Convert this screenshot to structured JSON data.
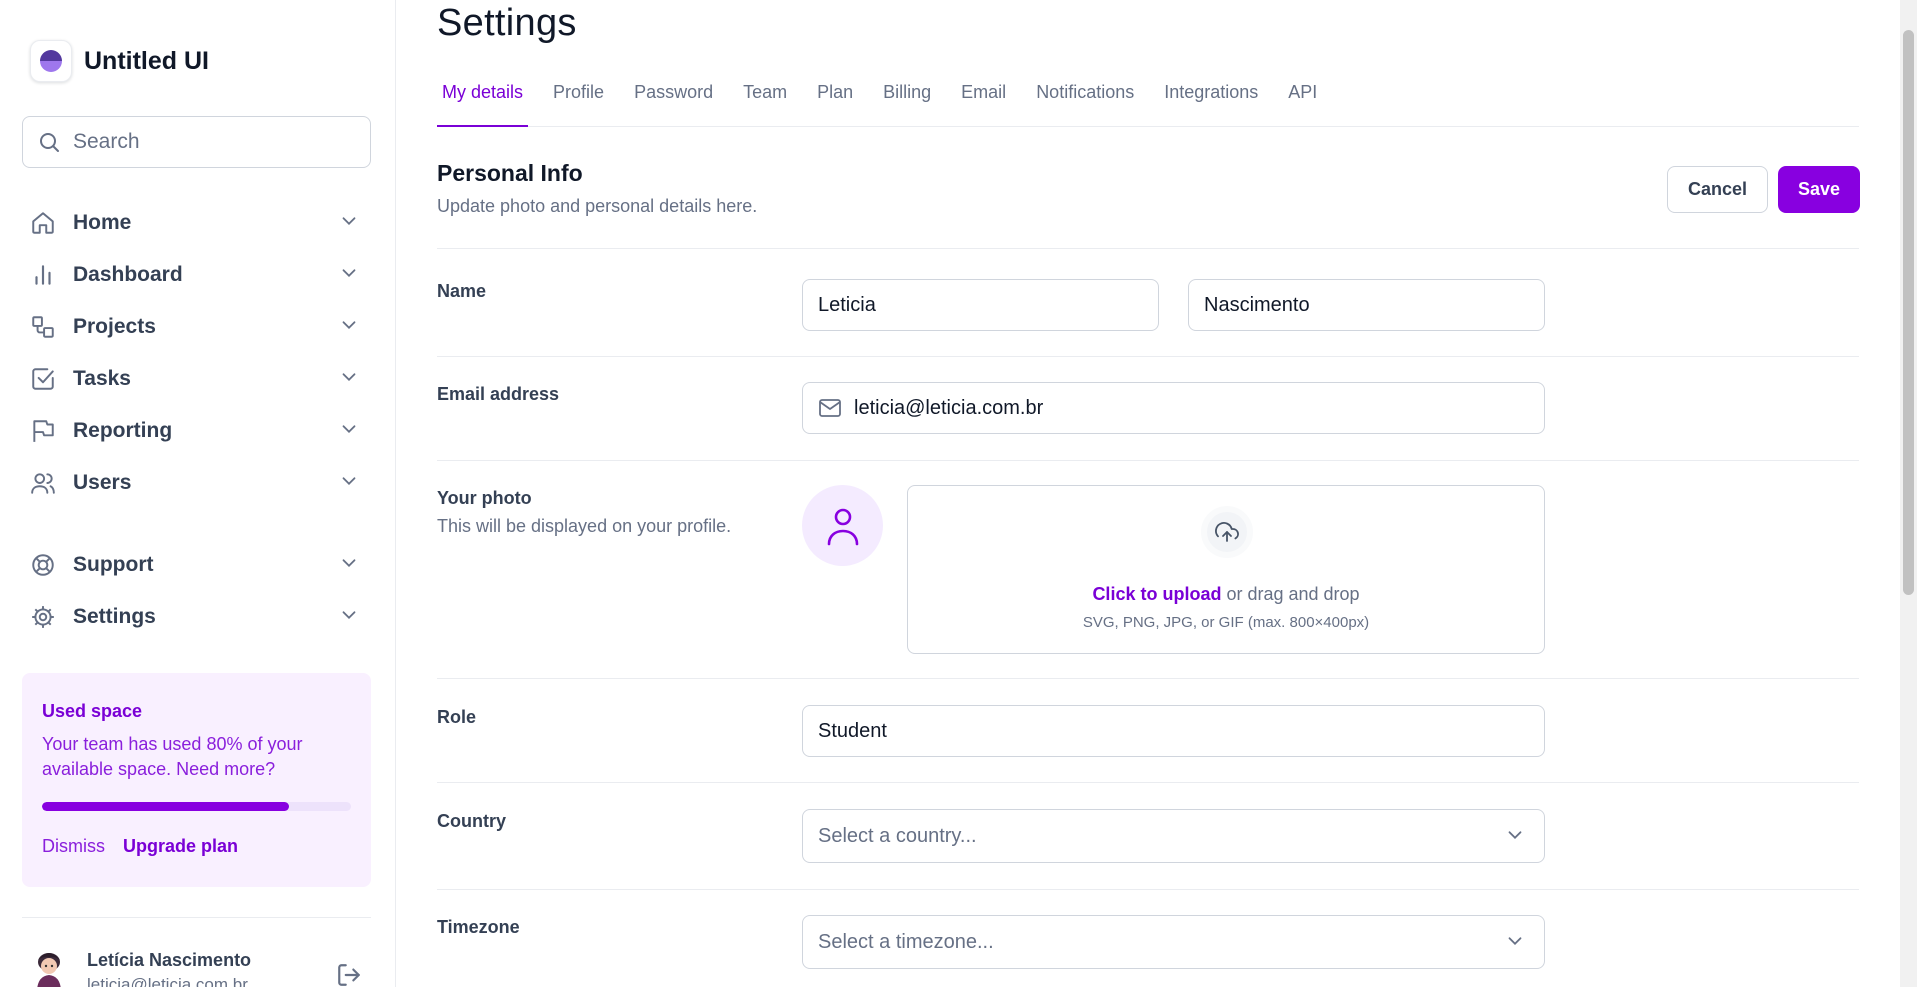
{
  "app": {
    "name": "Untitled UI"
  },
  "search": {
    "placeholder": "Search"
  },
  "sidebar": {
    "items": [
      {
        "label": "Home",
        "icon": "home-icon"
      },
      {
        "label": "Dashboard",
        "icon": "bar-chart-icon"
      },
      {
        "label": "Projects",
        "icon": "layers-icon"
      },
      {
        "label": "Tasks",
        "icon": "check-square-icon"
      },
      {
        "label": "Reporting",
        "icon": "flag-icon"
      },
      {
        "label": "Users",
        "icon": "users-icon"
      },
      {
        "label": "Support",
        "icon": "life-buoy-icon"
      },
      {
        "label": "Settings",
        "icon": "gear-icon"
      }
    ],
    "usage": {
      "title": "Used space",
      "text": "Your team has used 80% of your available space. Need more?",
      "percent": 80,
      "dismiss": "Dismiss",
      "upgrade": "Upgrade plan"
    },
    "user": {
      "name": "Letícia Nascimento",
      "email": "leticia@leticia.com.br"
    }
  },
  "page": {
    "title": "Settings",
    "tabs": [
      "My details",
      "Profile",
      "Password",
      "Team",
      "Plan",
      "Billing",
      "Email",
      "Notifications",
      "Integrations",
      "API"
    ],
    "active_tab": "My details"
  },
  "section": {
    "title": "Personal Info",
    "subtitle": "Update photo and personal details here.",
    "cancel": "Cancel",
    "save": "Save"
  },
  "form": {
    "name_label": "Name",
    "first_name": "Leticia",
    "last_name": "Nascimento",
    "email_label": "Email address",
    "email": "leticia@leticia.com.br",
    "photo_label": "Your photo",
    "photo_hint": "This will be displayed on your profile.",
    "upload_link": "Click to upload",
    "upload_text": " or drag and drop",
    "upload_hint": "SVG, PNG, JPG, or GIF (max. 800×400px)",
    "role_label": "Role",
    "role": "Student",
    "country_label": "Country",
    "country_placeholder": "Select a country...",
    "timezone_label": "Timezone",
    "timezone_placeholder": "Select a timezone..."
  },
  "colors": {
    "accent": "#7a00d6",
    "accent_button": "#8800e0",
    "usage_bg": "#f9f0ff",
    "text_primary": "#101828",
    "text_secondary": "#667085"
  }
}
